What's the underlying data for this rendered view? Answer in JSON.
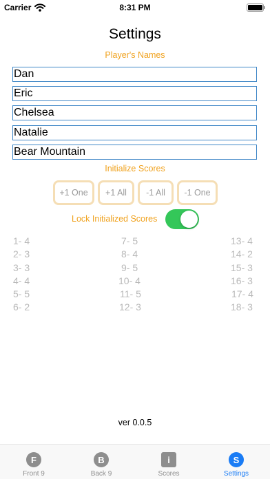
{
  "status_bar": {
    "carrier": "Carrier",
    "time": "8:31 PM"
  },
  "title": "Settings",
  "players": {
    "label": "Player's Names",
    "names": [
      "Dan",
      "Eric",
      "Chelsea",
      "Natalie",
      "Bear Mountain"
    ]
  },
  "initialize": {
    "label": "Initialize Scores",
    "buttons": [
      "+1 One",
      "+1 All",
      "-1 All",
      "-1 One"
    ]
  },
  "lock": {
    "label": "Lock Initialized Scores",
    "on": true
  },
  "scores": {
    "col1": [
      "1- 4",
      "2- 3",
      "3- 3",
      "4- 4",
      "5- 5",
      "6- 2"
    ],
    "col2": [
      "7- 5",
      "8- 4",
      "9- 5",
      "10- 4",
      "11- 5",
      "12- 3"
    ],
    "col3": [
      "13- 4",
      "14- 2",
      "15- 3",
      "16- 3",
      "17- 4",
      "18- 3"
    ]
  },
  "version": "ver 0.0.5",
  "tabs": [
    {
      "icon": "F",
      "label": "Front 9"
    },
    {
      "icon": "B",
      "label": "Back 9"
    },
    {
      "icon": "i",
      "label": "Scores"
    },
    {
      "icon": "S",
      "label": "Settings"
    }
  ],
  "colors": {
    "accent": "#f0a21e",
    "tint": "#1a7cf5",
    "toggle_on": "#34c759",
    "field_border": "#3d85c6"
  }
}
